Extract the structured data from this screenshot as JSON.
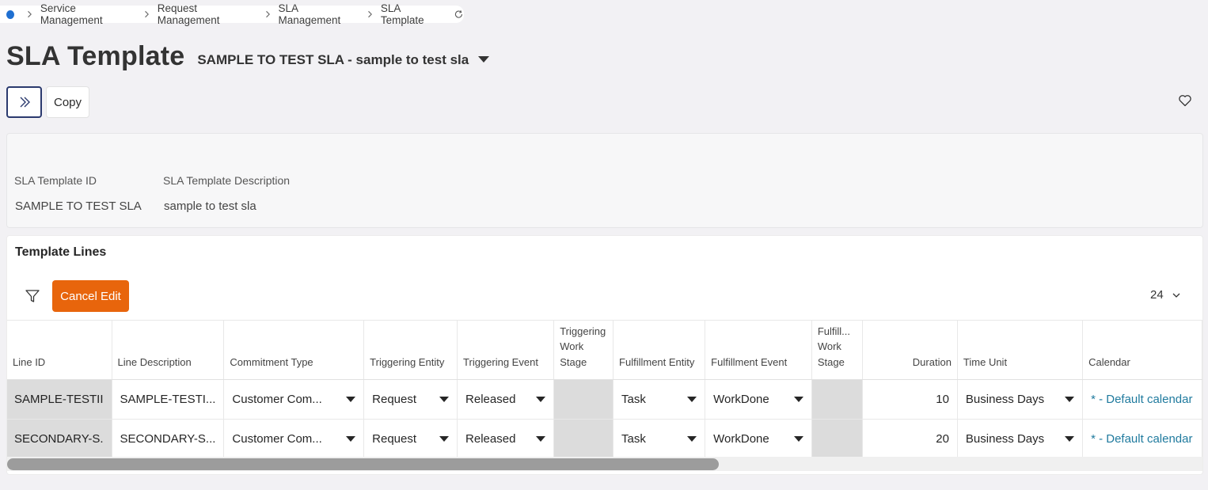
{
  "breadcrumb": {
    "items": [
      "Service Management",
      "Request Management",
      "SLA Management",
      "SLA Template"
    ]
  },
  "title": {
    "page": "SLA Template",
    "record": "SAMPLE TO TEST SLA - sample to test sla"
  },
  "toolbar": {
    "copy_label": "Copy"
  },
  "header": {
    "id_label": "SLA Template ID",
    "id_value": "SAMPLE TO TEST SLA",
    "desc_label": "SLA Template Description",
    "desc_value": "sample to test sla"
  },
  "lines": {
    "title": "Template Lines",
    "cancel_label": "Cancel Edit",
    "count": "24",
    "columns": [
      "Line ID",
      "Line Description",
      "Commitment Type",
      "Triggering Entity",
      "Triggering Event",
      "Triggering Work Stage",
      "Fulfillment Entity",
      "Fulfillment Event",
      "Fulfill... Work Stage",
      "Duration",
      "Time Unit",
      "Calendar"
    ],
    "rows": [
      {
        "line_id": "SAMPLE-TESTII",
        "description": "SAMPLE-TESTI...",
        "commitment_type": "Customer Com...",
        "triggering_entity": "Request",
        "triggering_event": "Released",
        "fulfillment_entity": "Task",
        "fulfillment_event": "WorkDone",
        "duration": "10",
        "time_unit": "Business Days",
        "calendar": "* - Default calendar"
      },
      {
        "line_id": "SECONDARY-S.",
        "description": "SECONDARY-S...",
        "commitment_type": "Customer Com...",
        "triggering_entity": "Request",
        "triggering_event": "Released",
        "fulfillment_entity": "Task",
        "fulfillment_event": "WorkDone",
        "duration": "20",
        "time_unit": "Business Days",
        "calendar": "* - Default calendar"
      }
    ]
  },
  "colors": {
    "accent_orange": "#e8650c",
    "link_blue": "#1f7a9e",
    "home_dot": "#1f6fd1"
  }
}
